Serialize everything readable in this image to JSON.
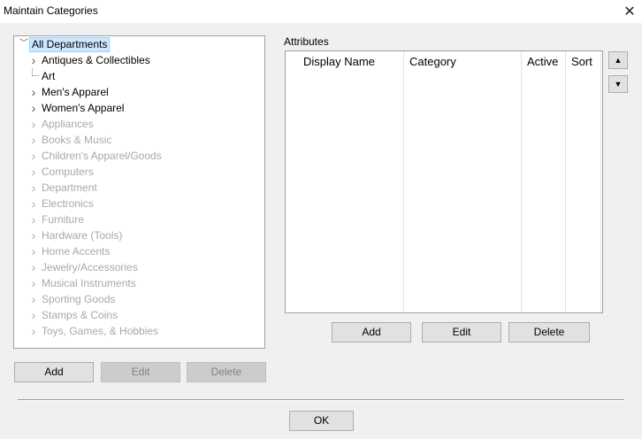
{
  "window": {
    "title": "Maintain Categories",
    "close_icon": "close-icon"
  },
  "tree": {
    "root": {
      "label": "All Departments",
      "expanded": true,
      "selected": true
    },
    "items": [
      {
        "label": "Antiques & Collectibles",
        "enabled": true,
        "has_children": true
      },
      {
        "label": "Art",
        "enabled": true,
        "has_children": false
      },
      {
        "label": "Men's Apparel",
        "enabled": true,
        "has_children": true
      },
      {
        "label": "Women's Apparel",
        "enabled": true,
        "has_children": true
      },
      {
        "label": "Appliances",
        "enabled": false,
        "has_children": true
      },
      {
        "label": "Books & Music",
        "enabled": false,
        "has_children": true
      },
      {
        "label": "Children's Apparel/Goods",
        "enabled": false,
        "has_children": true
      },
      {
        "label": "Computers",
        "enabled": false,
        "has_children": true
      },
      {
        "label": "Department",
        "enabled": false,
        "has_children": true
      },
      {
        "label": "Electronics",
        "enabled": false,
        "has_children": true
      },
      {
        "label": "Furniture",
        "enabled": false,
        "has_children": true
      },
      {
        "label": "Hardware (Tools)",
        "enabled": false,
        "has_children": true
      },
      {
        "label": "Home Accents",
        "enabled": false,
        "has_children": true
      },
      {
        "label": "Jewelry/Accessories",
        "enabled": false,
        "has_children": true
      },
      {
        "label": "Musical Instruments",
        "enabled": false,
        "has_children": true
      },
      {
        "label": "Sporting Goods",
        "enabled": false,
        "has_children": true
      },
      {
        "label": "Stamps & Coins",
        "enabled": false,
        "has_children": true
      },
      {
        "label": "Toys, Games, & Hobbies",
        "enabled": false,
        "has_children": true
      }
    ]
  },
  "category_buttons": {
    "add": {
      "label": "Add",
      "enabled": true
    },
    "edit": {
      "label": "Edit",
      "enabled": false
    },
    "delete": {
      "label": "Delete",
      "enabled": false
    }
  },
  "attributes": {
    "label": "Attributes",
    "columns": [
      {
        "label": "Display Name"
      },
      {
        "label": "Category"
      },
      {
        "label": "Active"
      },
      {
        "label": "Sort"
      }
    ],
    "rows": [],
    "move_up_icon": "triangle-up-icon",
    "move_down_icon": "triangle-down-icon"
  },
  "attribute_buttons": {
    "add": {
      "label": "Add",
      "enabled": true
    },
    "edit": {
      "label": "Edit",
      "enabled": true
    },
    "delete": {
      "label": "Delete",
      "enabled": true
    }
  },
  "footer": {
    "ok_label": "OK"
  }
}
